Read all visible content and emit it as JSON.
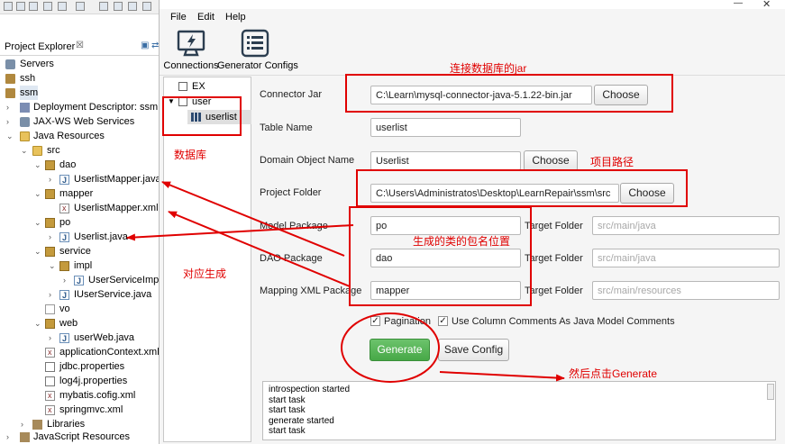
{
  "project_explorer": {
    "title": "Project Explorer",
    "close": "☒",
    "items": [
      {
        "label": "Servers"
      },
      {
        "label": "ssh"
      },
      {
        "label": "ssm"
      },
      {
        "label": "Deployment Descriptor: ssm"
      },
      {
        "label": "JAX-WS Web Services"
      },
      {
        "label": "Java Resources"
      },
      {
        "label": "src"
      },
      {
        "label": "dao"
      },
      {
        "label": "UserlistMapper.java"
      },
      {
        "label": "mapper"
      },
      {
        "label": "UserlistMapper.xml"
      },
      {
        "label": "po"
      },
      {
        "label": "Userlist.java"
      },
      {
        "label": "service"
      },
      {
        "label": "impl"
      },
      {
        "label": "UserServiceImpl.j"
      },
      {
        "label": "IUserService.java"
      },
      {
        "label": "vo"
      },
      {
        "label": "web"
      },
      {
        "label": "userWeb.java"
      },
      {
        "label": "applicationContext.xml"
      },
      {
        "label": "jdbc.properties"
      },
      {
        "label": "log4j.properties"
      },
      {
        "label": "mybatis.cofig.xml"
      },
      {
        "label": "springmvc.xml"
      },
      {
        "label": "Libraries"
      },
      {
        "label": "JavaScript Resources"
      }
    ]
  },
  "generator": {
    "menu": [
      "File",
      "Edit",
      "Help"
    ],
    "toolbar": {
      "connections": "Connections",
      "generator_configs": "Generator Configs"
    },
    "db_tree": {
      "items": [
        "EX",
        "user",
        "userlist"
      ]
    },
    "form": {
      "connector_jar_label": "Connector Jar",
      "connector_jar_value": "C:\\Learn\\mysql-connector-java-5.1.22-bin.jar",
      "choose": "Choose",
      "table_name_label": "Table Name",
      "table_name_value": "userlist",
      "domain_object_label": "Domain Object Name",
      "domain_object_value": "Userlist",
      "project_folder_label": "Project Folder",
      "project_folder_value": "C:\\Users\\Administratos\\Desktop\\LearnRepair\\ssm\\src",
      "model_package_label": "Model Package",
      "model_package_value": "po",
      "dao_package_label": "DAO Package",
      "dao_package_value": "dao",
      "mapping_xml_label": "Mapping XML Package",
      "mapping_xml_value": "mapper",
      "target_folder_label": "Target Folder",
      "target_model_placeholder": "src/main/java",
      "target_dao_placeholder": "src/main/java",
      "target_xml_placeholder": "src/main/resources",
      "pagination_label": "Pagination",
      "column_comments_label": "Use Column Comments As Java Model Comments",
      "generate": "Generate",
      "save_config": "Save Config"
    },
    "log_lines": [
      "introspection started",
      "start task",
      "start task",
      "generate started",
      "start task"
    ]
  },
  "annotations": {
    "connect_jar": "连接数据库的jar",
    "database": "数据库",
    "project_path": "项目路径",
    "package_location": "生成的类的包名位置",
    "corresponding": "对应生成",
    "then_click": "然后点击Generate"
  },
  "colors": {
    "annotation_red": "#e00000",
    "generate_green": "#4cae4c"
  }
}
